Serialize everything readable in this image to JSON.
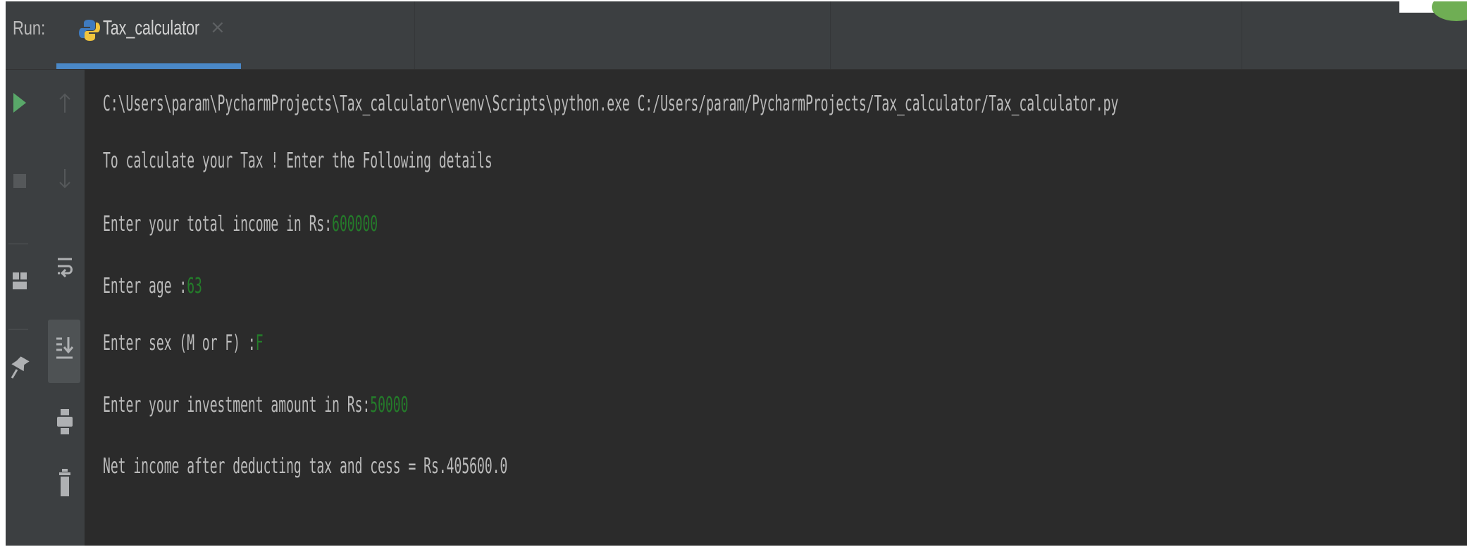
{
  "header": {
    "run_label": "Run:",
    "tab_label": "Tax_calculator",
    "tab_close": "×",
    "accent_color": "#4a88c7"
  },
  "toolbar": {
    "icons": [
      "run-icon",
      "up-arrow-icon",
      "stop-icon",
      "down-arrow-icon",
      "layout-icon",
      "soft-wrap-icon",
      "scroll-to-end-icon",
      "pin-icon",
      "print-icon",
      "trash-icon"
    ]
  },
  "console": {
    "command": "C:\\Users\\param\\PycharmProjects\\Tax_calculator\\venv\\Scripts\\python.exe C:/Users/param/PycharmProjects/Tax_calculator/Tax_calculator.py",
    "intro": "To calculate your Tax ! Enter the Following details",
    "income_prompt": "Enter your total income in Rs:",
    "income_value": "600000",
    "age_prompt": "Enter age :",
    "age_value": "63",
    "sex_prompt": "Enter sex (M or F) :",
    "sex_value": "F",
    "investment_prompt": "Enter your investment amount in Rs:",
    "investment_value": "50000",
    "result": "Net income after deducting tax and cess = Rs.405600.0",
    "text_color": "#bbbbbb",
    "input_color": "#247c2a"
  }
}
